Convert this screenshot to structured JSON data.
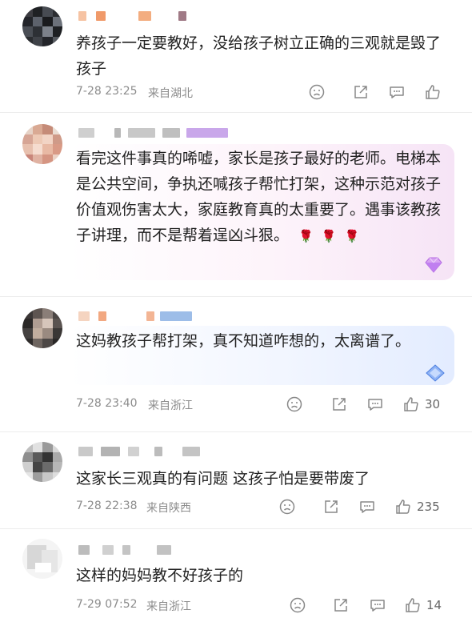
{
  "comments": [
    {
      "text": "养孩子一定要教好，没给孩子树立正确的三观就是毁了孩子",
      "time": "7-28 23:25",
      "location": "来自湖北",
      "likes": ""
    },
    {
      "text": "看完这件事真的唏嘘，家长是孩子最好的老师。电梯本是公共空间，争执还喊孩子帮忙打架，这种示范对孩子价值观伤害太大，家庭教育真的太重要了。遇事该教孩子讲理，而不是帮着逞凶斗狠。",
      "emoji": [
        "🌹",
        "🌹",
        "🌹"
      ]
    },
    {
      "text": "这妈教孩子帮打架，真不知道咋想的，太离谱了。",
      "time": "7-28 23:40",
      "location": "来自浙江",
      "likes": "30"
    },
    {
      "text": "这家长三观真的有问题 这孩子怕是要带废了",
      "time": "7-28 22:38",
      "location": "来自陕西",
      "likes": "235"
    },
    {
      "text": "这样的妈妈教不好孩子的",
      "time": "7-29 07:52",
      "location": "来自浙江",
      "likes": "14"
    }
  ],
  "icons": {
    "dislike": "sad-face-icon",
    "share": "share-icon",
    "reply": "comment-icon",
    "like": "thumbs-up-icon"
  },
  "colors": {
    "meta_text": "#8c8c8c",
    "bubble_pink": "#f6e4f6",
    "bubble_blue": "#e3ecff"
  }
}
